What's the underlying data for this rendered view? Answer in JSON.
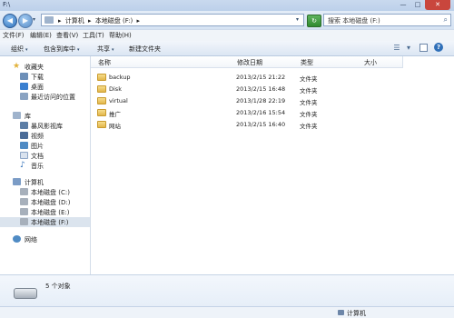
{
  "window": {
    "title": "F:\\",
    "minimize": "—",
    "maximize": "□",
    "close": "✕"
  },
  "address": {
    "back_icon": "arrow-left",
    "forward_icon": "arrow-right",
    "segments": [
      "▸",
      "计算机",
      "▸",
      "本地磁盘 (F:)",
      "▸"
    ],
    "dropdown": "▾",
    "refresh_icon": "refresh",
    "search_placeholder": "搜索 本地磁盘 (F:)",
    "search_icon": "magnifier"
  },
  "menu": [
    "文件(F)",
    "编辑(E)",
    "查看(V)",
    "工具(T)",
    "帮助(H)"
  ],
  "commands": [
    "组织",
    "包含到库中",
    "共享",
    "新建文件夹"
  ],
  "command_arrow": "▾",
  "nav": {
    "favorites": {
      "label": "收藏夹",
      "items": [
        "下载",
        "桌面",
        "最近访问的位置"
      ]
    },
    "libraries": {
      "label": "库",
      "items": [
        "暴风影视库",
        "视频",
        "图片",
        "文档",
        "音乐"
      ]
    },
    "computer": {
      "label": "计算机",
      "items": [
        "本地磁盘 (C:)",
        "本地磁盘 (D:)",
        "本地磁盘 (E:)",
        "本地磁盘 (F:)"
      ]
    },
    "network": {
      "label": "网络"
    }
  },
  "columns": [
    "名称",
    "修改日期",
    "类型",
    "大小"
  ],
  "files": [
    {
      "name": "backup",
      "date": "2013/2/15 21:22",
      "type": "文件夹"
    },
    {
      "name": "Disk",
      "date": "2013/2/15 16:48",
      "type": "文件夹"
    },
    {
      "name": "virtual",
      "date": "2013/1/28 22:19",
      "type": "文件夹"
    },
    {
      "name": "推广",
      "date": "2013/2/16 15:54",
      "type": "文件夹"
    },
    {
      "name": "网站",
      "date": "2013/2/15 16:40",
      "type": "文件夹"
    }
  ],
  "details": {
    "count_text": "5 个对象"
  },
  "status": {
    "location": "计算机"
  },
  "colors": {
    "accent": "#2f6fb8",
    "folder": "#e2b64a",
    "selection": "#dbe4ee"
  }
}
